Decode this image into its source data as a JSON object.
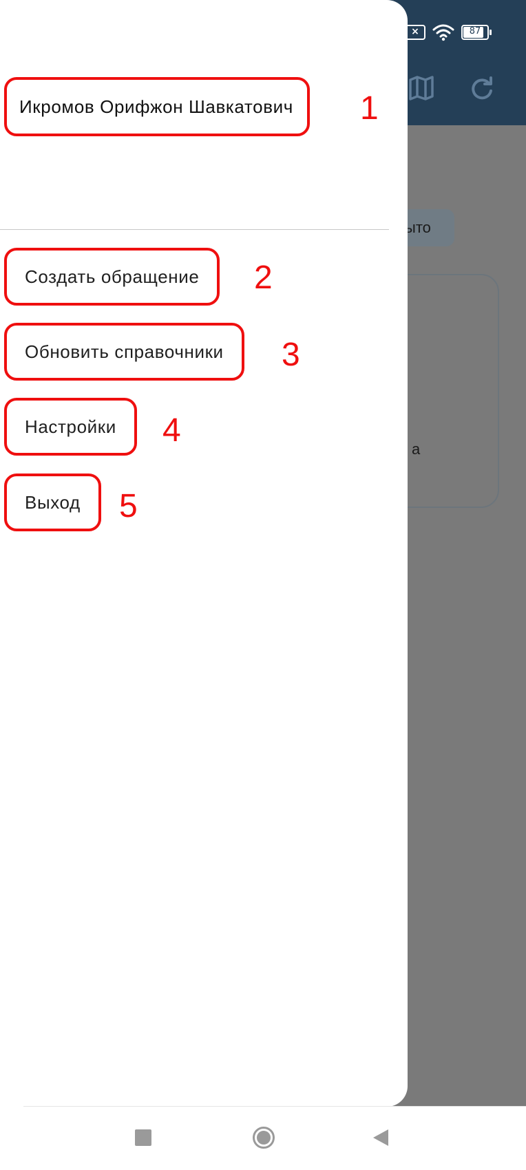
{
  "status_bar": {
    "sim_icon": "sim-no-signal-icon",
    "wifi_icon": "wifi-icon",
    "battery_level": "87",
    "battery_fraction": 0.87
  },
  "app_header": {
    "color": "#243f57",
    "actions": [
      {
        "icon": "map-icon"
      },
      {
        "icon": "refresh-icon"
      }
    ]
  },
  "background": {
    "chip_text": "ыто",
    "card_text": "а"
  },
  "drawer": {
    "user_name": "Икромов Орифжон Шавкатович",
    "items": [
      {
        "label": "Создать обращение"
      },
      {
        "label": "Обновить справочники"
      },
      {
        "label": "Настройки"
      },
      {
        "label": "Выход"
      }
    ]
  },
  "annotations": {
    "marker_color": "#ef0f0f",
    "markers": [
      "1",
      "2",
      "3",
      "4",
      "5"
    ]
  },
  "nav_bar": {
    "buttons": [
      {
        "icon": "recent-apps-icon"
      },
      {
        "icon": "home-icon"
      },
      {
        "icon": "back-icon"
      }
    ]
  }
}
